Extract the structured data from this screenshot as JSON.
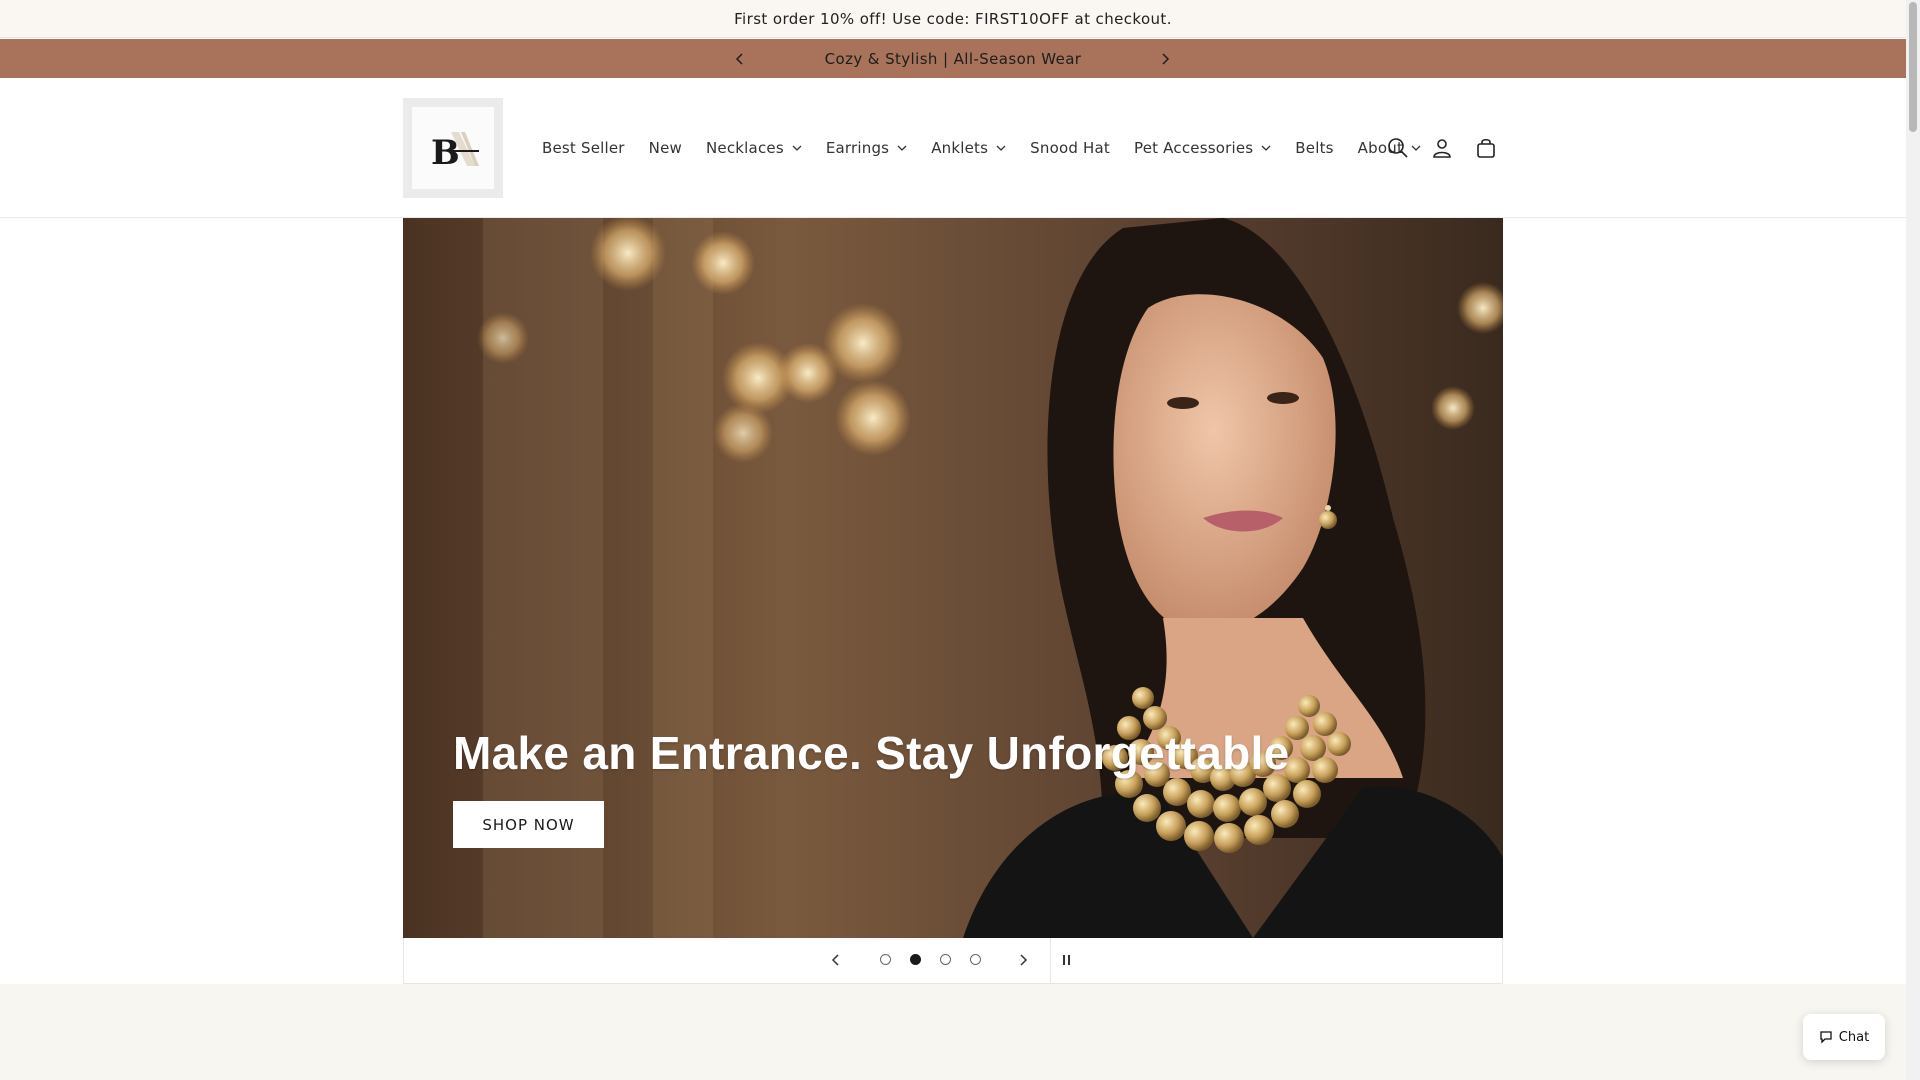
{
  "top_bar": {
    "text": "First order 10% off! Use code: FIRST10OFF at checkout."
  },
  "announcement": {
    "text": "Cozy & Stylish | All-Season Wear",
    "prev_icon": "chevron-left-icon",
    "next_icon": "chevron-right-icon",
    "bg_color": "#a8735a"
  },
  "header": {
    "logo_text": "BA",
    "nav": [
      {
        "label": "Best Seller",
        "dropdown": false
      },
      {
        "label": "New",
        "dropdown": false
      },
      {
        "label": "Necklaces",
        "dropdown": true
      },
      {
        "label": "Earrings",
        "dropdown": true
      },
      {
        "label": "Anklets",
        "dropdown": true
      },
      {
        "label": "Snood Hat",
        "dropdown": false
      },
      {
        "label": "Pet Accessories",
        "dropdown": true
      },
      {
        "label": "Belts",
        "dropdown": false
      },
      {
        "label": "About",
        "dropdown": true
      }
    ],
    "icons": [
      "search-icon",
      "account-icon",
      "cart-icon"
    ]
  },
  "hero": {
    "title": "Make an Entrance. Stay Unforgettable",
    "button_label": "SHOP NOW"
  },
  "slider": {
    "slide_count": 4,
    "active_index": 1
  },
  "chat": {
    "label": "Chat"
  }
}
